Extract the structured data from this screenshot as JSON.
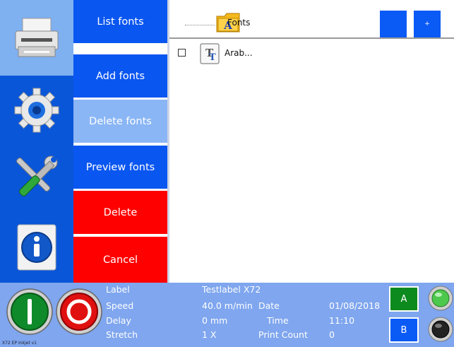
{
  "menu": {
    "list_fonts": "List fonts",
    "add_fonts": "Add fonts",
    "delete_fonts": "Delete fonts",
    "preview_fonts": "Preview fonts",
    "delete": "Delete",
    "cancel": "Cancel"
  },
  "file_panel": {
    "folder_label": "Fonts",
    "btn_small_plus": "+",
    "items": [
      {
        "label": "Arab...",
        "checked": false
      }
    ]
  },
  "status": {
    "label_key": "Label",
    "label_value": "Testlabel X72",
    "speed_key": "Speed",
    "speed_value": "40.0 m/min",
    "date_key": "Date",
    "date_value": "01/08/2018",
    "delay_key": "Delay",
    "delay_value": "0 mm",
    "time_key": "Time",
    "time_value": "11:10",
    "stretch_key": "Stretch",
    "stretch_value": "1 X",
    "print_count_key": "Print Count",
    "print_count_value": "0",
    "btn_a": "A",
    "btn_b": "B",
    "version": "X72 EP Inkjet v1"
  },
  "colors": {
    "menu_blue": "#0a56f0",
    "menu_lightblue": "#8ab6f5",
    "menu_red": "#ff0000",
    "status_bg": "#7fa6ee",
    "lamp_a": "#4cc84c",
    "lamp_b": "#222222"
  },
  "icons": [
    "printer-icon",
    "gear-icon",
    "tools-icon",
    "info-icon",
    "folder-font-icon",
    "truetype-font-icon",
    "start-icon",
    "stop-icon"
  ]
}
